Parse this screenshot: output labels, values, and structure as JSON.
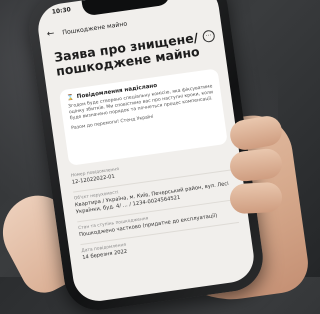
{
  "status": {
    "time": "10:30"
  },
  "nav": {
    "title": "Пошкоджене майно"
  },
  "page": {
    "title": "Заява про знищене/ пошкоджене майно",
    "menu_glyph": "···"
  },
  "alert": {
    "title": "Повідомлення надіслано",
    "body": "Згодом буде створено спеціальну комісію, яка фіксуватиме оцінку збитків. Ми сповістимо вас про наступні кроки, коли буде визначено порядок та почнеться процес компенсації.",
    "signature": "Разом до перемоги! Стенд Україні"
  },
  "fields": [
    {
      "label": "Номер повідомлення",
      "value": "12-12022022-01"
    },
    {
      "label": "Об'єкт нерухомості",
      "value": "Квартира / Україна, м. Київ, Печерський район, вул. Лесі Українки, буд. 4/ ... / 1234-0024564521"
    },
    {
      "label": "Стан та ступінь пошкодження",
      "value": "Пошкоджено частково (придатне до експлуатації)"
    },
    {
      "label": "Дата повідомлення",
      "value": "14 березня 2022"
    }
  ],
  "colors": {
    "screen_bg": "#f1efec",
    "card_bg": "#ffffff",
    "phone_frame": "#111213"
  }
}
